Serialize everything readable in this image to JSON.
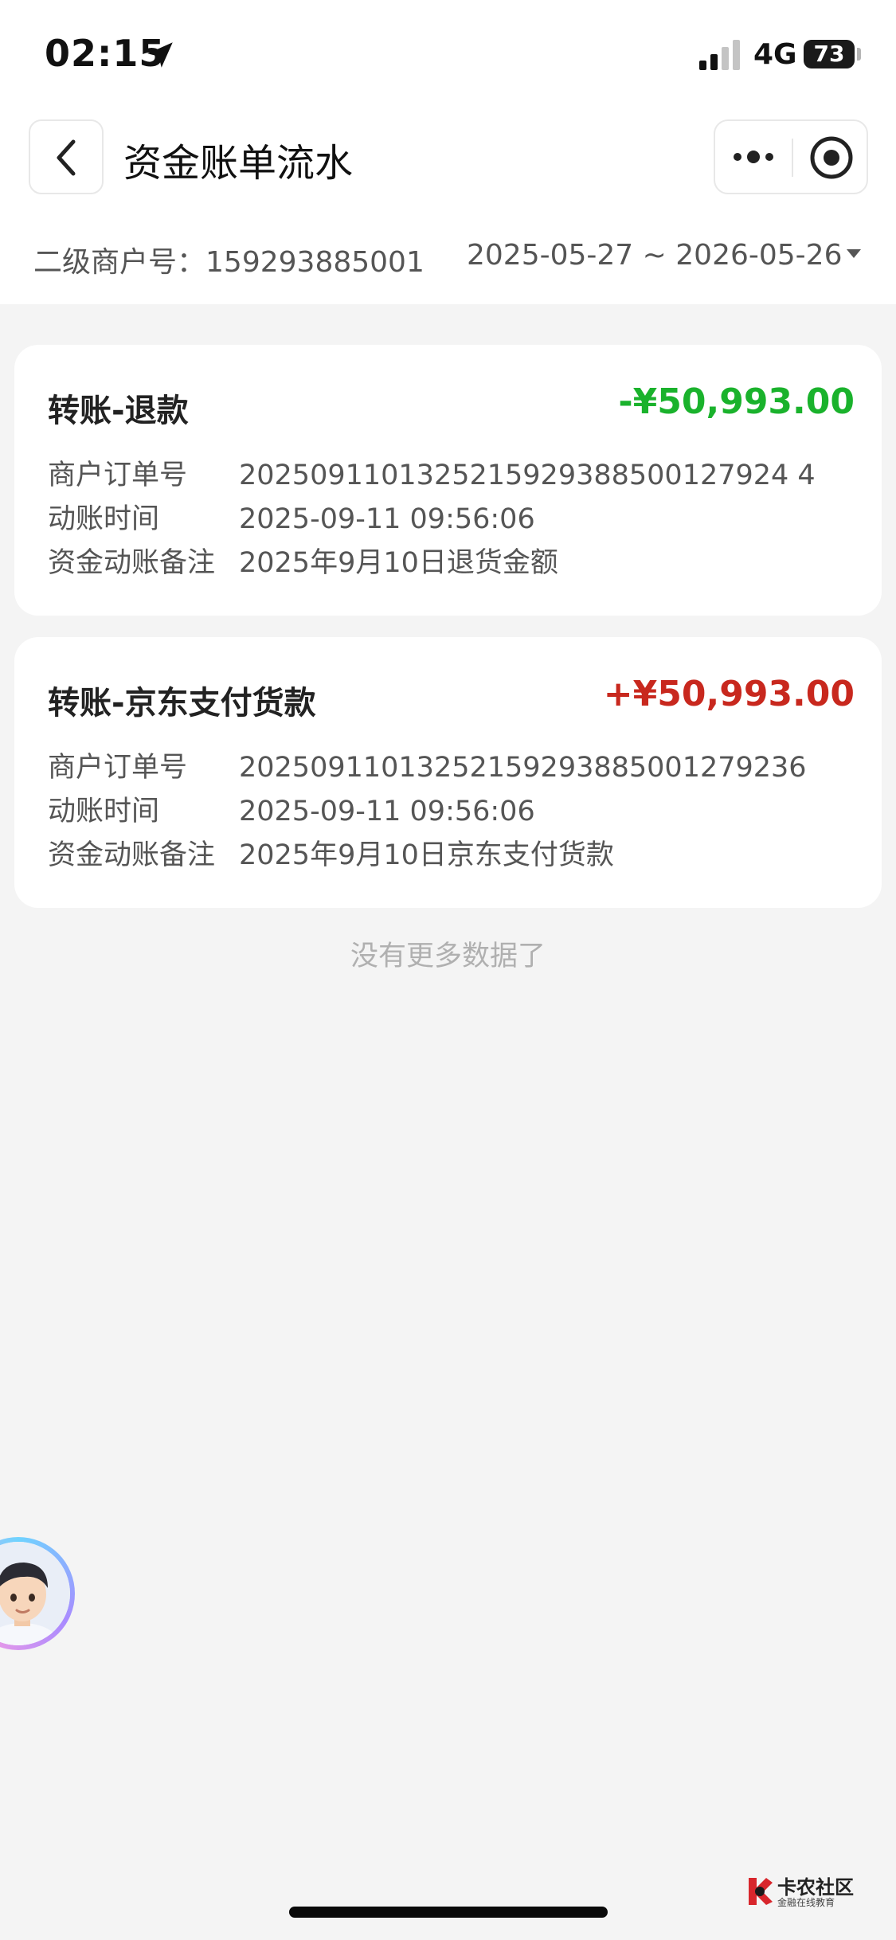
{
  "status_bar": {
    "time": "02:15",
    "network": "4G",
    "battery": "73"
  },
  "nav": {
    "title": "资金账单流水"
  },
  "filter": {
    "merchant_label": "二级商户号：",
    "merchant_no": "159293885001",
    "date_range": "2025-05-27 ~ 2026-05-26"
  },
  "records": [
    {
      "title": "转账-退款",
      "amount": "-¥50,993.00",
      "amount_color": "#1ab22c",
      "fields": [
        {
          "label": "商户订单号",
          "value": "2025091101325215929388500127924 4"
        },
        {
          "label": "动账时间",
          "value": "2025-09-11 09:56:06"
        },
        {
          "label": "资金动账备注",
          "value": "2025年9月10日退货金额"
        }
      ]
    },
    {
      "title": "转账-京东支付货款",
      "amount": "+¥50,993.00",
      "amount_color": "#c8281e",
      "fields": [
        {
          "label": "商户订单号",
          "value": "20250911013252159293885001279236"
        },
        {
          "label": "动账时间",
          "value": "2025-09-11 09:56:06"
        },
        {
          "label": "资金动账备注",
          "value": "2025年9月10日京东支付货款"
        }
      ]
    }
  ],
  "footer": {
    "no_more": "没有更多数据了"
  },
  "watermark": {
    "title": "卡农社区",
    "subtitle": "金融在线教育"
  }
}
